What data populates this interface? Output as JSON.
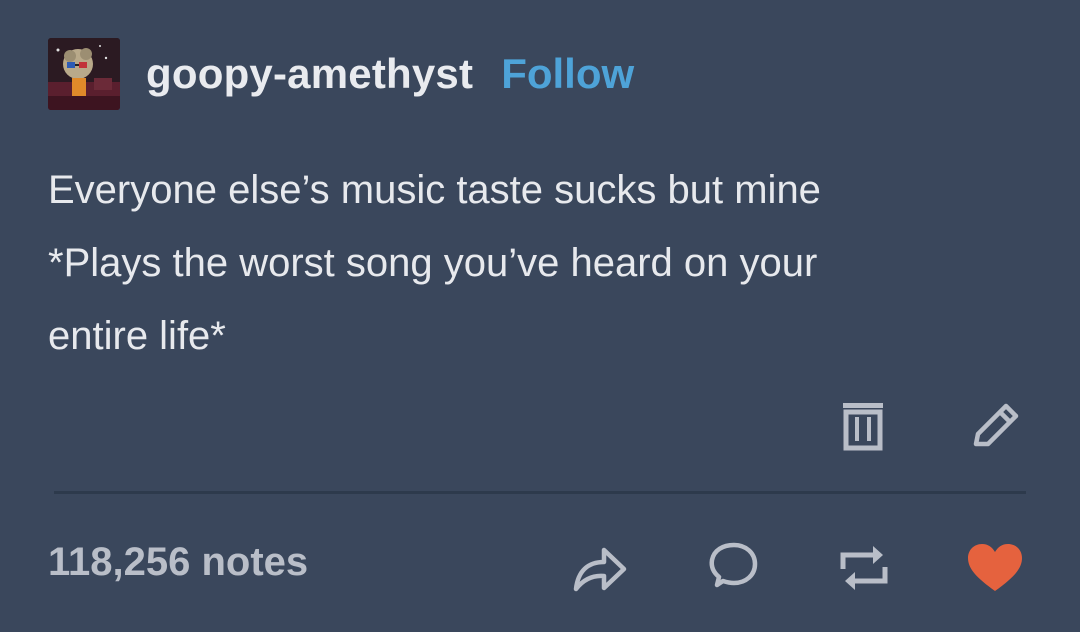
{
  "post": {
    "username": "goopy-amethyst",
    "follow_label": "Follow",
    "body_lines": [
      "Everyone else’s music taste sucks but mine",
      "*Plays the worst song you’ve heard on your",
      "entire life*"
    ],
    "notes_label": "118,256 notes"
  },
  "icons": {
    "delete": "trash-icon",
    "edit": "pencil-icon",
    "share": "share-icon",
    "reply": "speech-bubble-icon",
    "reblog": "reblog-icon",
    "like": "heart-icon"
  },
  "colors": {
    "background": "#3a475c",
    "follow": "#4ea3d8",
    "like_active": "#e5623e",
    "icon": "#b9bec8"
  }
}
